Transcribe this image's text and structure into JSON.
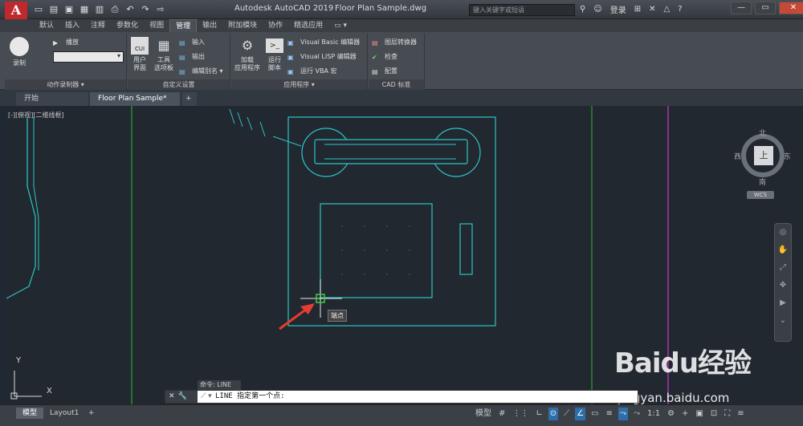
{
  "titlebar": {
    "app_icon": "A",
    "title": "Autodesk AutoCAD 2019",
    "file": "Floor Plan Sample.dwg",
    "search_placeholder": "键入关键字或短语",
    "login": "登录",
    "help": "?"
  },
  "ribbon_tabs": [
    "默认",
    "插入",
    "注释",
    "参数化",
    "视图",
    "管理",
    "输出",
    "附加模块",
    "协作",
    "精选应用"
  ],
  "active_tab": "管理",
  "ribbon": {
    "action_recorder": {
      "record": "录制",
      "play": "播放",
      "title": "动作录制器"
    },
    "customize": {
      "cui_icon": "CUI",
      "user_interface": [
        "用户",
        "界面"
      ],
      "tool_palettes": [
        "工具",
        "选项板"
      ],
      "import": "输入",
      "export": "输出",
      "edit_aliases": "编辑别名",
      "title": "自定义设置"
    },
    "applications": {
      "load_app": [
        "加载",
        "应用程序"
      ],
      "run_script": [
        "运行",
        "脚本"
      ],
      "vba_editor": "Visual Basic 编辑器",
      "lisp_editor": "Visual LISP 编辑器",
      "run_vba": "运行 VBA 宏",
      "title": "应用程序"
    },
    "cad_standards": {
      "layer_translator": "图层转换器",
      "check": "检查",
      "configure": "配置",
      "title": "CAD 标准"
    }
  },
  "file_tabs": [
    "开始",
    "Floor Plan Sample*"
  ],
  "viewport_label": "[-][俯视][二维线框]",
  "viewcube": {
    "north": "北",
    "south": "南",
    "east": "东",
    "west": "西",
    "top": "上",
    "wcs": "WCS"
  },
  "tooltip": "端点",
  "command": {
    "history": "命令: LINE",
    "prompt": "LINE 指定第一个点:"
  },
  "status": {
    "model_tab": "模型",
    "layout_tab": "Layout1",
    "model_label": "模型",
    "scale": "1:1"
  },
  "watermark": {
    "brand": "Baidu经验",
    "url": "jingyan.baidu.com"
  },
  "ucs": {
    "x": "X",
    "y": "Y"
  }
}
